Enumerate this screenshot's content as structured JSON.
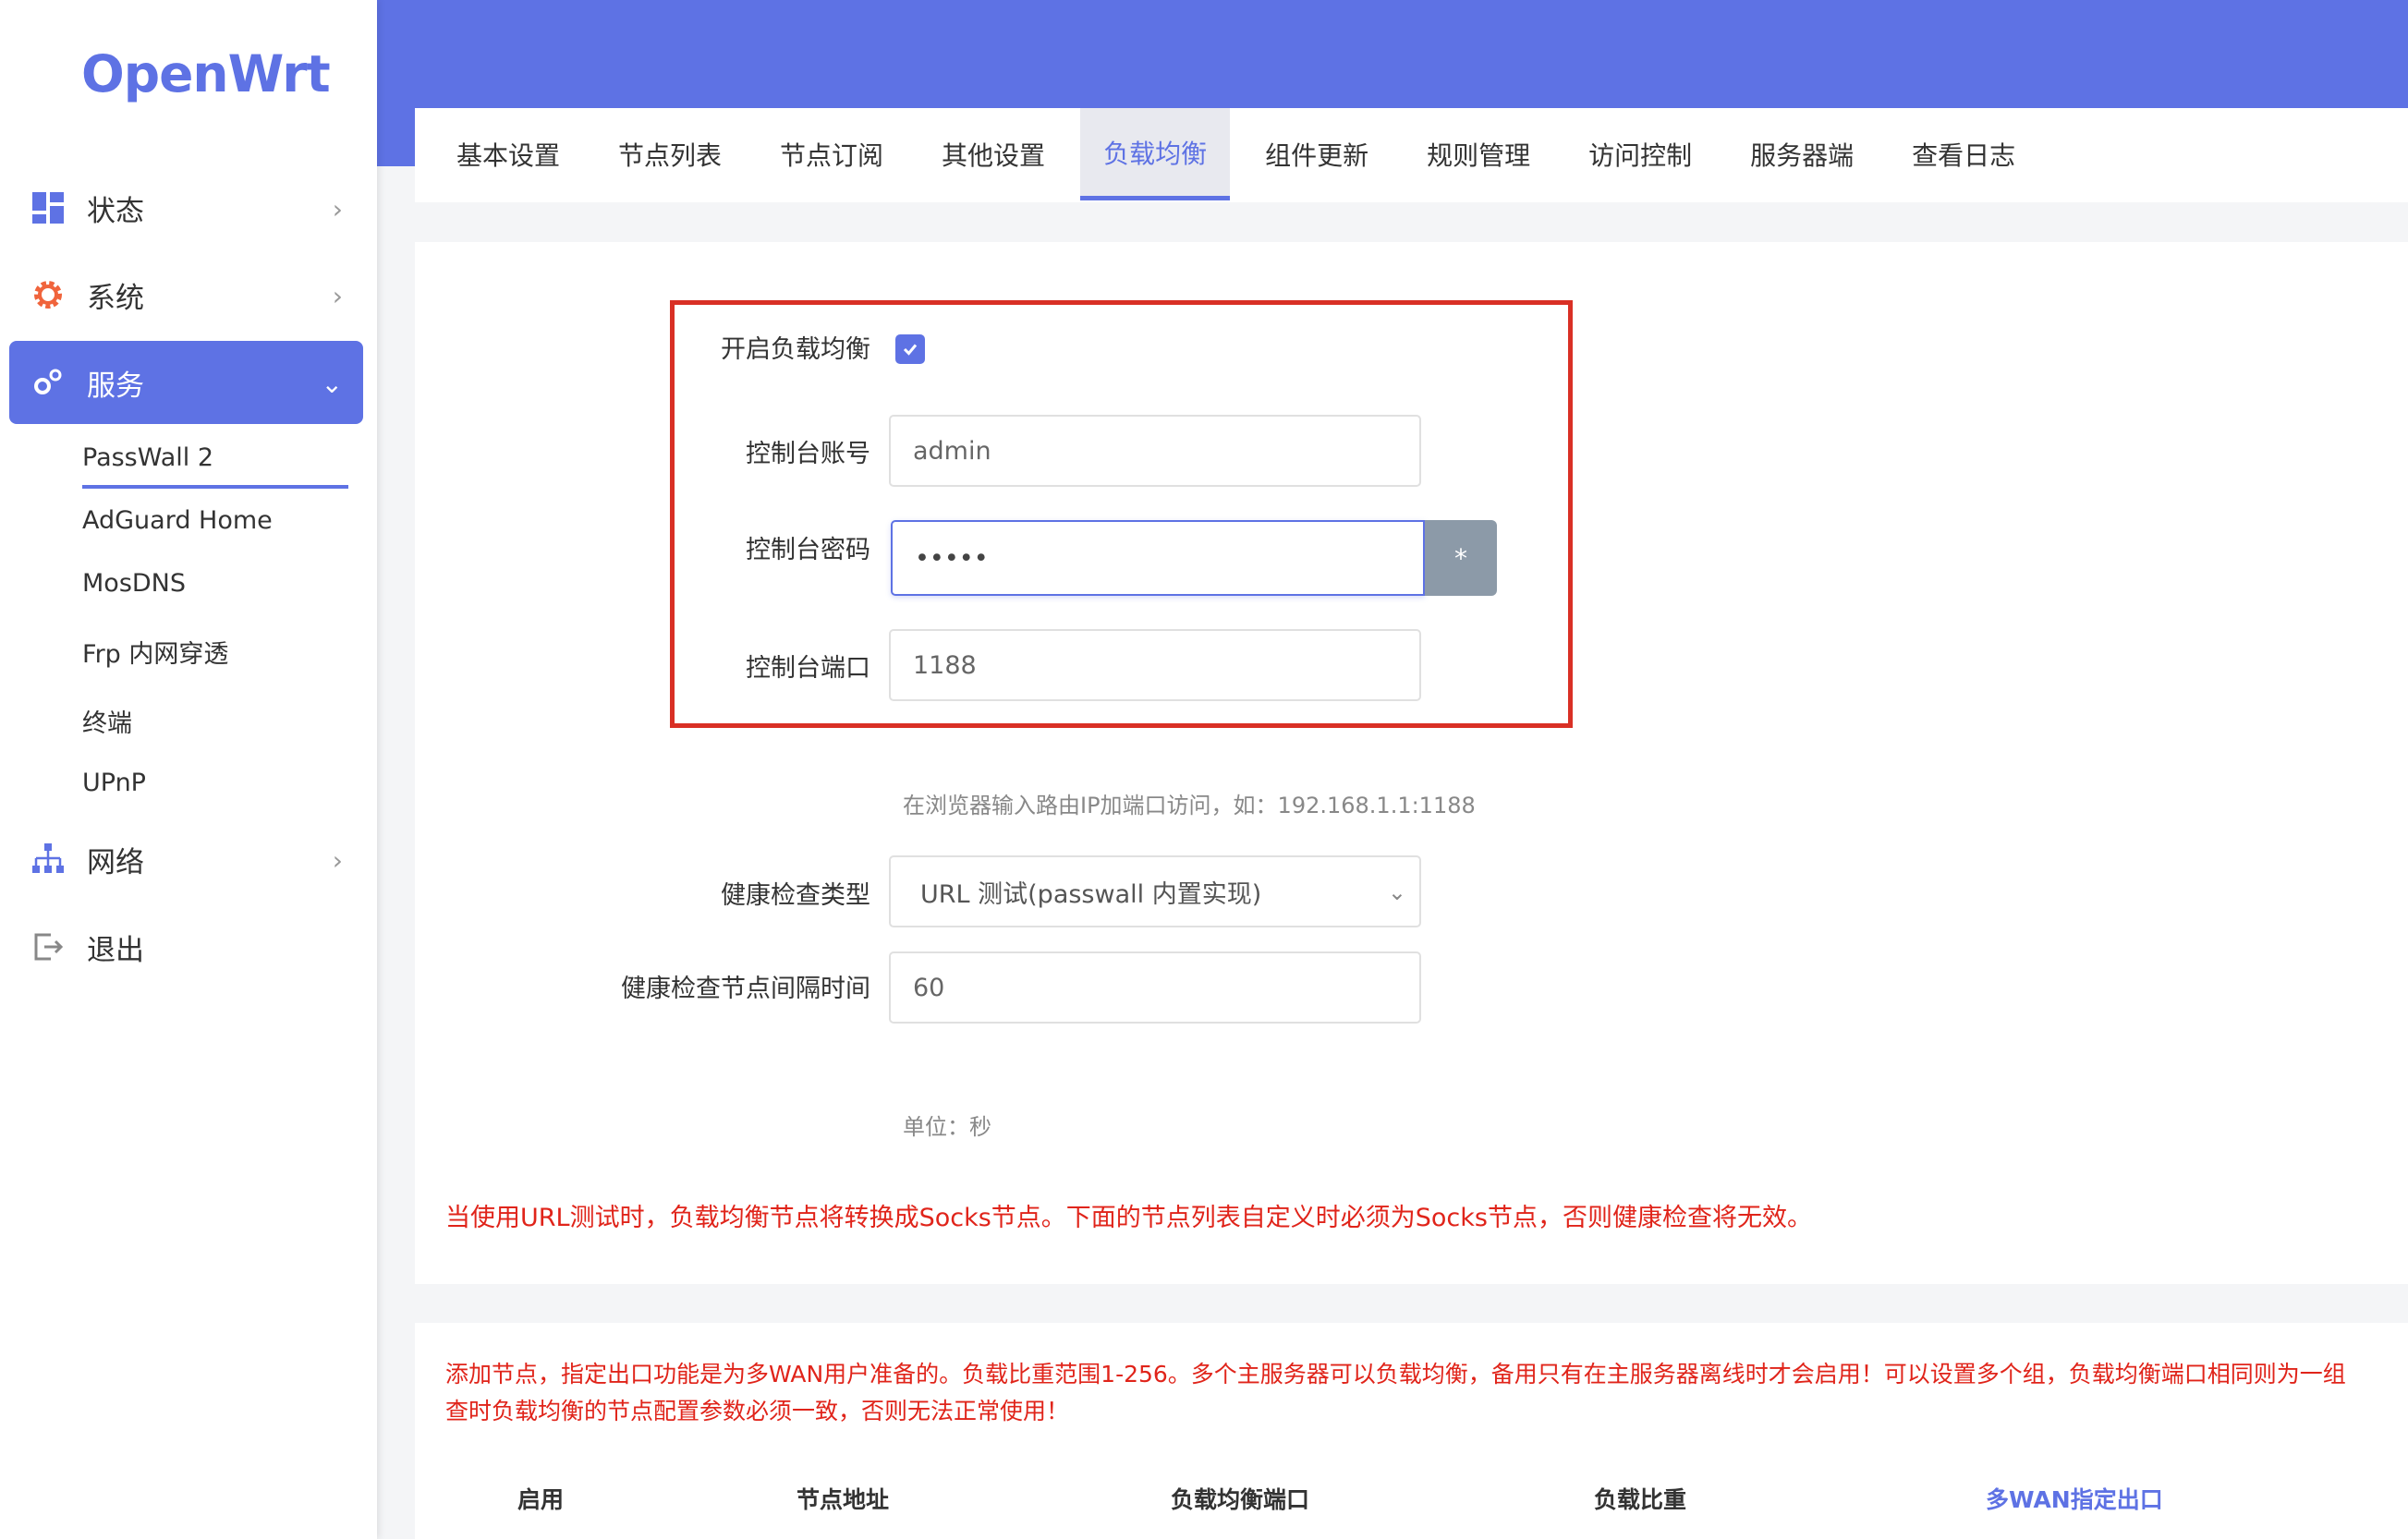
{
  "app": {
    "logo": "OpenWrt"
  },
  "sidebar": {
    "items": [
      {
        "label": "状态",
        "icon": "dashboard-icon"
      },
      {
        "label": "系统",
        "icon": "gear-icon"
      },
      {
        "label": "服务",
        "icon": "services-icon"
      },
      {
        "label": "网络",
        "icon": "network-icon"
      },
      {
        "label": "退出",
        "icon": "logout-icon"
      }
    ],
    "sub_items": [
      "PassWall 2",
      "AdGuard Home",
      "MosDNS",
      "Frp 内网穿透",
      "终端",
      "UPnP"
    ]
  },
  "tabs": [
    "基本设置",
    "节点列表",
    "节点订阅",
    "其他设置",
    "负载均衡",
    "组件更新",
    "规则管理",
    "访问控制",
    "服务器端",
    "查看日志"
  ],
  "form": {
    "enable_label": "开启负载均衡",
    "account_label": "控制台账号",
    "account_value": "admin",
    "password_label": "控制台密码",
    "password_value": "•••••",
    "reveal_label": "*",
    "port_label": "控制台端口",
    "port_value": "1188",
    "port_hint": "在浏览器输入路由IP加端口访问，如：192.168.1.1:1188",
    "health_type_label": "健康检查类型",
    "health_type_value": "URL 测试(passwall 内置实现)",
    "health_interval_label": "健康检查节点间隔时间",
    "health_interval_value": "60",
    "unit_hint": "单位：秒",
    "warning": "当使用URL测试时，负载均衡节点将转换成Socks节点。下面的节点列表自定义时必须为Socks节点，否则健康检查将无效。"
  },
  "section2": {
    "note_line1": "添加节点，指定出口功能是为多WAN用户准备的。负载比重范围1-256。多个主服务器可以负载均衡，备用只有在主服务器离线时才会启用！可以设置多个组，负载均衡端口相同则为一组",
    "note_line2": "查时负载均衡的节点配置参数必须一致，否则无法正常使用！",
    "columns": [
      "启用",
      "节点地址",
      "负载均衡端口",
      "负载比重",
      "多WAN指定出口"
    ]
  },
  "colors": {
    "accent": "#5e72e4",
    "warning": "#e0241a",
    "highlight_box": "#d93025"
  }
}
